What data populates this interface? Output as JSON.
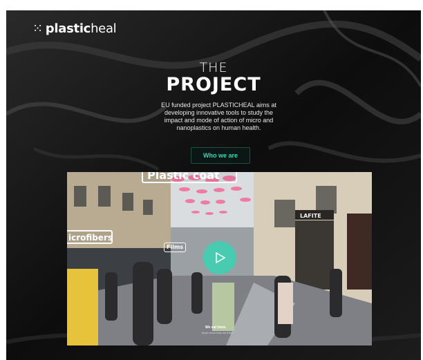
{
  "brand": {
    "logo_mark": "⁙",
    "logo_prefix": "plastic",
    "logo_suffix": "heal"
  },
  "hero": {
    "title_small": "THE",
    "title_big": "PROJECT",
    "description": "EU funded project PLASTICHEAL aims at developing innovative tools to study the impact and mode of action of micro and nanoplastics on human health.",
    "cta_label": "Who we are"
  },
  "video": {
    "labels": {
      "plastic_coat": "Plastic coat",
      "microfibers": "icrofibers",
      "films": "Films"
    },
    "caption_main": "We eat them.",
    "caption_sub": "Much more than we think",
    "shop_sign": "LAFITE"
  },
  "colors": {
    "accent": "#35d7b4",
    "page_bg": "#0b0b0b"
  }
}
